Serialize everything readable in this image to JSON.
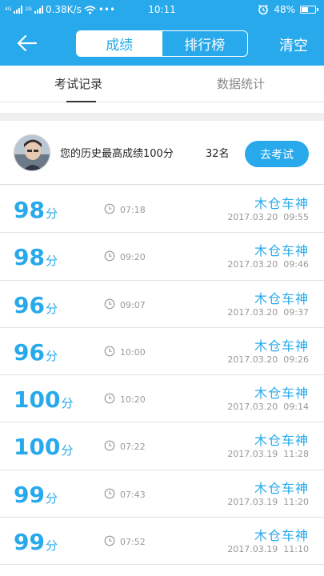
{
  "status_bar": {
    "network_left": "4G",
    "network_right": "2G",
    "speed": "0.38K/s",
    "dots": "•••",
    "time": "10:11",
    "battery": "48%",
    "battery_level": 0.48
  },
  "header": {
    "tab_scores": "成绩",
    "tab_ranking": "排行榜",
    "clear_label": "清空",
    "accent_color": "#27a9ec"
  },
  "subtabs": {
    "records": "考试记录",
    "stats": "数据统计"
  },
  "profile": {
    "best_score_text": "您的历史最高成绩100分",
    "rank_text": "32名",
    "exam_button": "去考试"
  },
  "records": [
    {
      "score": "98",
      "unit": "分",
      "duration": "07:18",
      "name": "木仓车神",
      "datetime": "2017.03.20  09:55"
    },
    {
      "score": "98",
      "unit": "分",
      "duration": "09:20",
      "name": "木仓车神",
      "datetime": "2017.03.20  09:46"
    },
    {
      "score": "96",
      "unit": "分",
      "duration": "09:07",
      "name": "木仓车神",
      "datetime": "2017.03.20  09:37"
    },
    {
      "score": "96",
      "unit": "分",
      "duration": "10:00",
      "name": "木仓车神",
      "datetime": "2017.03.20  09:26"
    },
    {
      "score": "100",
      "unit": "分",
      "duration": "10:20",
      "name": "木仓车神",
      "datetime": "2017.03.20  09:14"
    },
    {
      "score": "100",
      "unit": "分",
      "duration": "07:22",
      "name": "木仓车神",
      "datetime": "2017.03.19  11:28"
    },
    {
      "score": "99",
      "unit": "分",
      "duration": "07:43",
      "name": "木仓车神",
      "datetime": "2017.03.19  11:20"
    },
    {
      "score": "99",
      "unit": "分",
      "duration": "07:52",
      "name": "木仓车神",
      "datetime": "2017.03.19  11:10"
    }
  ],
  "icons": {
    "back": "arrow-left-icon",
    "clock": "clock-icon",
    "alarm": "alarm-icon",
    "wifi": "wifi-icon",
    "battery": "battery-icon"
  }
}
